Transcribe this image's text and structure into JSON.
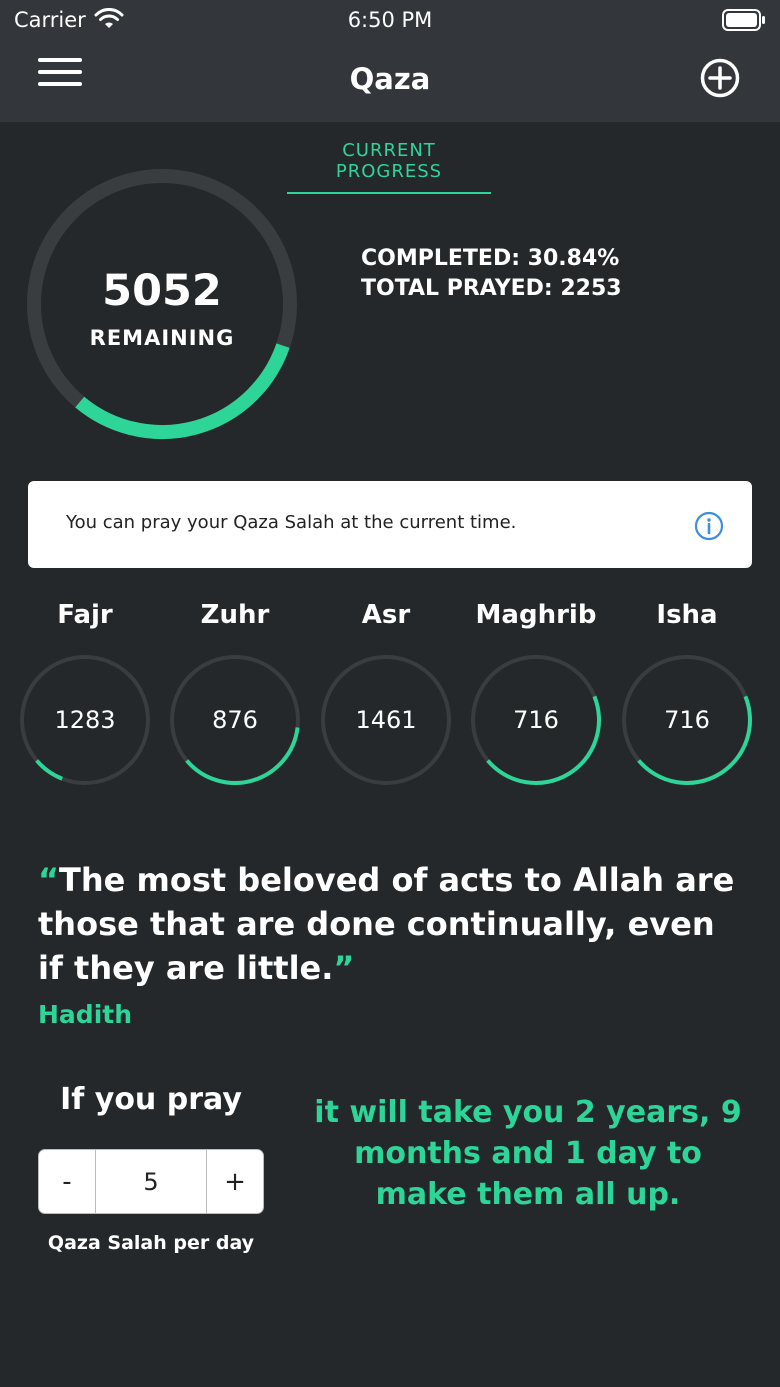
{
  "status_bar": {
    "carrier": "Carrier",
    "time": "6:50 PM"
  },
  "nav": {
    "title": "Qaza",
    "menu_icon": "hamburger-icon",
    "add_icon": "plus-circle-icon"
  },
  "tab": {
    "label": "CURRENT PROGRESS"
  },
  "progress": {
    "remaining": "5052",
    "remaining_label": "REMAINING",
    "completed": "COMPLETED: 30.84%",
    "total_prayed": "TOTAL PRAYED: 2253",
    "completed_fraction": 0.3084
  },
  "info": {
    "text": "You can pray your Qaza Salah at the current time.",
    "icon": "info-icon"
  },
  "prayers": [
    {
      "name": "Fajr",
      "count": "1283",
      "fraction": 0.08
    },
    {
      "name": "Zuhr",
      "count": "876",
      "fraction": 0.37
    },
    {
      "name": "Asr",
      "count": "1461",
      "fraction": 0.0
    },
    {
      "name": "Maghrib",
      "count": "716",
      "fraction": 0.45
    },
    {
      "name": "Isha",
      "count": "716",
      "fraction": 0.45
    }
  ],
  "quote": {
    "open_mark": "“",
    "text": "The most beloved of acts to Allah are those that are done continually, even if they are little.",
    "close_mark": "”",
    "source": "Hadith"
  },
  "calculator": {
    "label": "If you pray",
    "minus": "-",
    "value": "5",
    "plus": "+",
    "caption": "Qaza Salah per day",
    "result": "it will take you 2 years, 9 months and 1 day to make them all up."
  },
  "colors": {
    "accent": "#2ed598",
    "background": "#25282a",
    "bar": "#33363a",
    "track": "#3a3d40"
  }
}
